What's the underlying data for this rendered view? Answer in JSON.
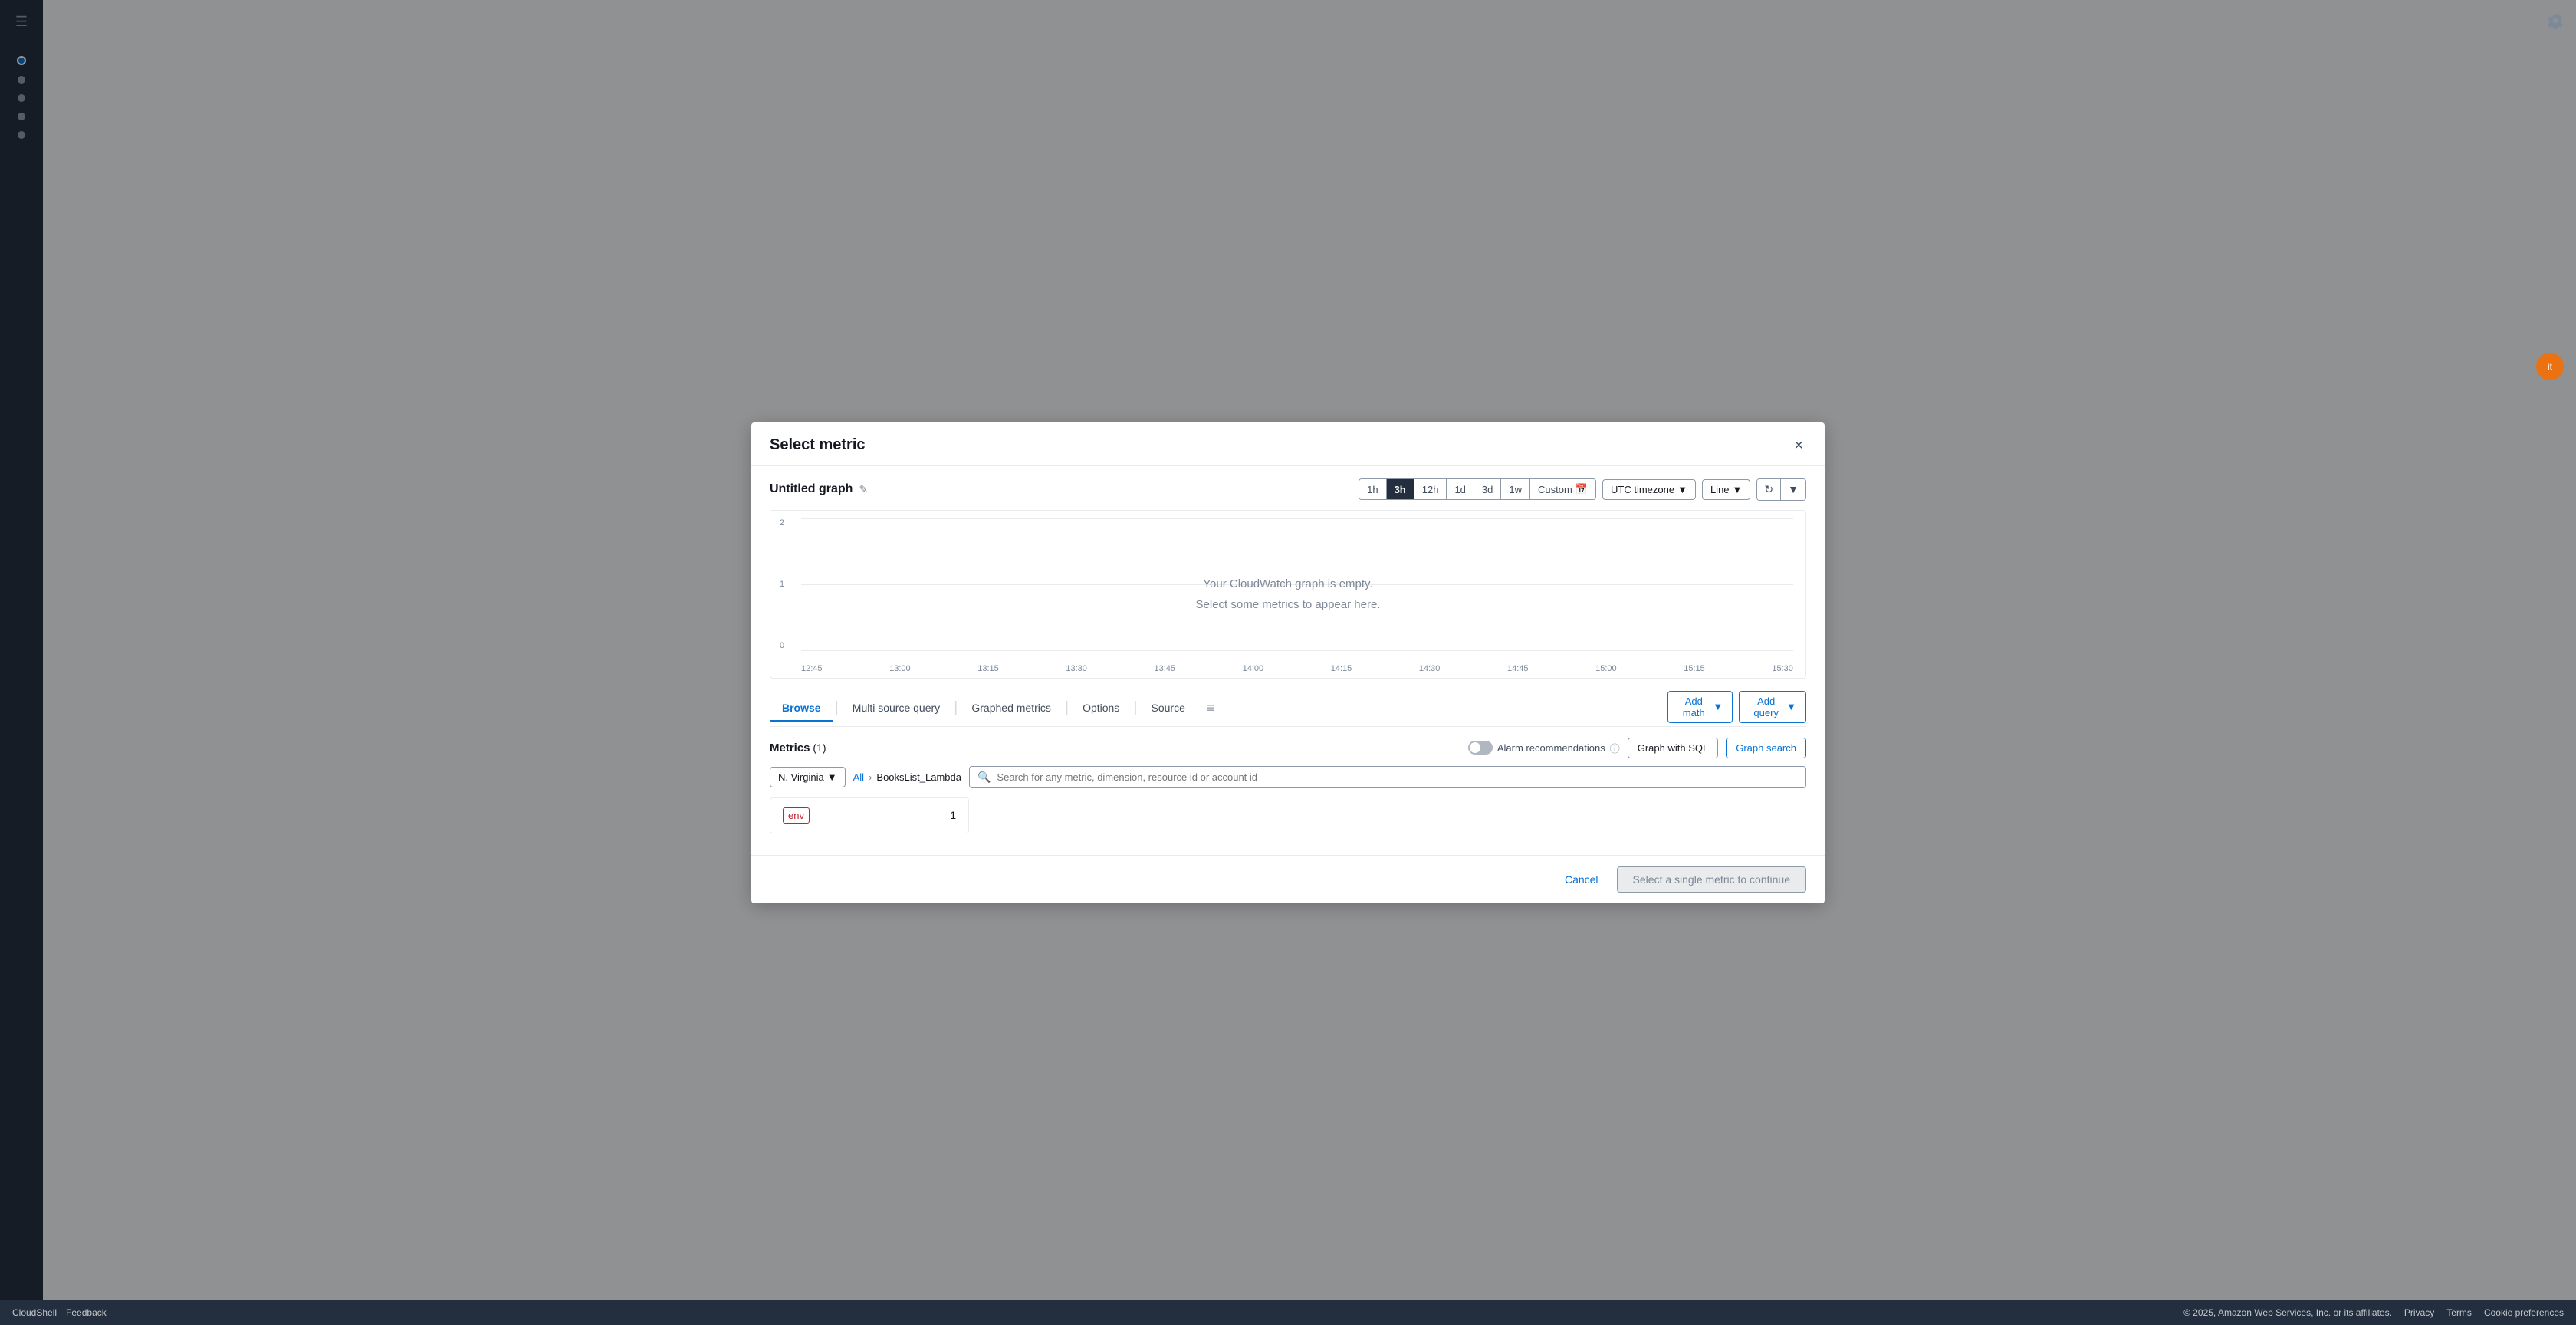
{
  "modal": {
    "title": "Select metric",
    "close_label": "×"
  },
  "graph": {
    "title": "Untitled graph",
    "edit_icon": "✎",
    "empty_line1": "Your CloudWatch graph is empty.",
    "empty_line2": "Select some metrics to appear here."
  },
  "time_controls": {
    "buttons": [
      "1h",
      "3h",
      "12h",
      "1d",
      "3d",
      "1w"
    ],
    "active": "3h",
    "custom_label": "Custom",
    "timezone_label": "UTC timezone",
    "line_label": "Line"
  },
  "chart": {
    "y_labels": [
      "2",
      "1",
      "0"
    ],
    "x_labels": [
      "12:45",
      "13:00",
      "13:15",
      "13:30",
      "13:45",
      "14:00",
      "14:15",
      "14:30",
      "14:45",
      "15:00",
      "15:15",
      "15:30"
    ]
  },
  "tabs": {
    "items": [
      {
        "label": "Browse",
        "active": true
      },
      {
        "label": "Multi source query",
        "active": false
      },
      {
        "label": "Graphed metrics",
        "active": false
      },
      {
        "label": "Options",
        "active": false
      },
      {
        "label": "Source",
        "active": false
      }
    ],
    "add_math_label": "Add math",
    "add_query_label": "Add query"
  },
  "metrics": {
    "title": "Metrics",
    "count": "(1)",
    "alarm_rec_label": "Alarm recommendations",
    "graph_sql_label": "Graph with SQL",
    "graph_search_label": "Graph search"
  },
  "browse": {
    "region_label": "N. Virginia",
    "breadcrumb_all": "All",
    "breadcrumb_current": "BooksList_Lambda",
    "search_placeholder": "Search for any metric, dimension, resource id or account id"
  },
  "metric_card": {
    "tag": "env",
    "count": "1"
  },
  "footer": {
    "cancel_label": "Cancel",
    "continue_label": "Select a single metric to continue"
  },
  "bottom_bar": {
    "cloudshell_label": "CloudShell",
    "feedback_label": "Feedback",
    "copyright": "© 2025, Amazon Web Services, Inc. or its affiliates.",
    "privacy_label": "Privacy",
    "terms_label": "Terms",
    "cookie_label": "Cookie preferences"
  }
}
